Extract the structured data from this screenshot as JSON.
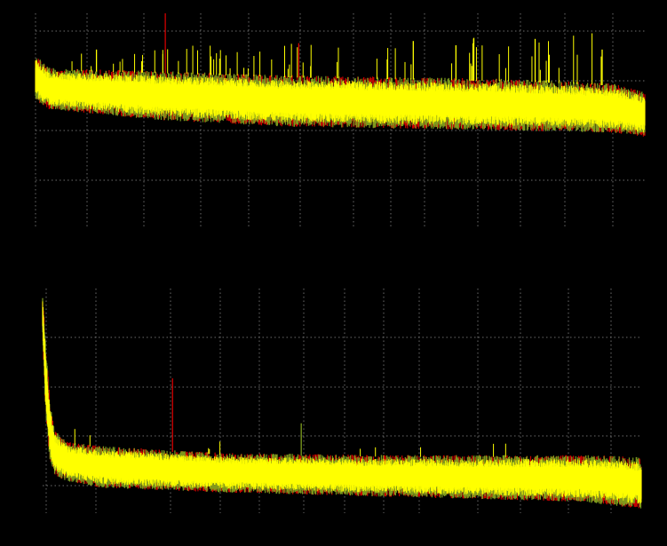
{
  "figure": {
    "background": "#000000",
    "colors": {
      "primary": "#ffff00",
      "secondary": "#d40000",
      "tertiary": "#7fa01e",
      "grid": "#9a9a9a"
    }
  },
  "chart_data": [
    {
      "type": "line",
      "title": "",
      "xlabel": "",
      "ylabel": "",
      "grid": true,
      "legend": "none",
      "xlim": [
        0,
        1
      ],
      "ylim": [
        0,
        1
      ],
      "num_points": 1300,
      "series": [
        {
          "color": "#ffff00",
          "envelope": {
            "x": [
              0.0,
              0.02,
              0.05,
              0.2,
              0.4,
              0.6,
              0.8,
              0.95,
              1.0
            ],
            "upper": [
              0.8,
              0.74,
              0.73,
              0.72,
              0.7,
              0.69,
              0.68,
              0.66,
              0.62
            ],
            "lower": [
              0.6,
              0.56,
              0.55,
              0.51,
              0.48,
              0.47,
              0.46,
              0.45,
              0.43
            ]
          }
        },
        {
          "color": "#d40000",
          "envelope_ref": 0
        },
        {
          "color": "#7fa01e",
          "envelope_ref": 0
        }
      ],
      "spikes": [
        {
          "x": 0.213,
          "y": 1.0,
          "color": "#d40000"
        },
        {
          "x": 0.432,
          "y": 0.86,
          "color": "#d40000"
        },
        {
          "x": 0.1,
          "y": 0.83,
          "color": "#ffff00"
        },
        {
          "x": 0.62,
          "y": 0.87,
          "color": "#ffff00"
        },
        {
          "x": 0.69,
          "y": 0.85,
          "color": "#ffff00"
        },
        {
          "x": 0.82,
          "y": 0.88,
          "color": "#ffff00"
        },
        {
          "x": 0.93,
          "y": 0.83,
          "color": "#ffff00"
        }
      ]
    },
    {
      "type": "line",
      "title": "",
      "xlabel": "",
      "ylabel": "",
      "grid": true,
      "legend": "none",
      "xlim": [
        0,
        1
      ],
      "ylim": [
        0,
        1
      ],
      "num_points": 1300,
      "series": [
        {
          "color": "#ffff00",
          "envelope": {
            "x": [
              0.0,
              0.005,
              0.012,
              0.02,
              0.04,
              0.1,
              0.3,
              0.6,
              0.9,
              1.0
            ],
            "upper": [
              0.96,
              0.75,
              0.5,
              0.36,
              0.31,
              0.29,
              0.26,
              0.25,
              0.25,
              0.24
            ],
            "lower": [
              0.8,
              0.45,
              0.25,
              0.18,
              0.15,
              0.12,
              0.1,
              0.08,
              0.06,
              0.03
            ]
          }
        },
        {
          "color": "#d40000",
          "envelope_ref": 0
        },
        {
          "color": "#7fa01e",
          "envelope_ref": 0
        }
      ],
      "spikes": [
        {
          "x": 0.217,
          "y": 0.6,
          "color": "#d40000"
        },
        {
          "x": 0.432,
          "y": 0.4,
          "color": "#7fa01e"
        }
      ]
    }
  ]
}
